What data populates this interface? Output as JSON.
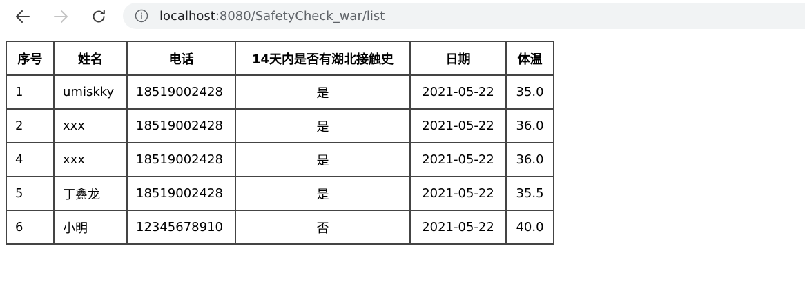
{
  "browser": {
    "url_host": "localhost",
    "url_path": ":8080/SafetyCheck_war/list"
  },
  "table": {
    "headers": [
      "序号",
      "姓名",
      "电话",
      "14天内是否有湖北接触史",
      "日期",
      "体温"
    ],
    "rows": [
      [
        "1",
        "umiskky",
        "18519002428",
        "是",
        "2021-05-22",
        "35.0"
      ],
      [
        "2",
        "xxx",
        "18519002428",
        "是",
        "2021-05-22",
        "36.0"
      ],
      [
        "4",
        "xxx",
        "18519002428",
        "是",
        "2021-05-22",
        "36.0"
      ],
      [
        "5",
        "丁鑫龙",
        "18519002428",
        "是",
        "2021-05-22",
        "35.5"
      ],
      [
        "6",
        "小明",
        "12345678910",
        "否",
        "2021-05-22",
        "40.0"
      ]
    ]
  }
}
